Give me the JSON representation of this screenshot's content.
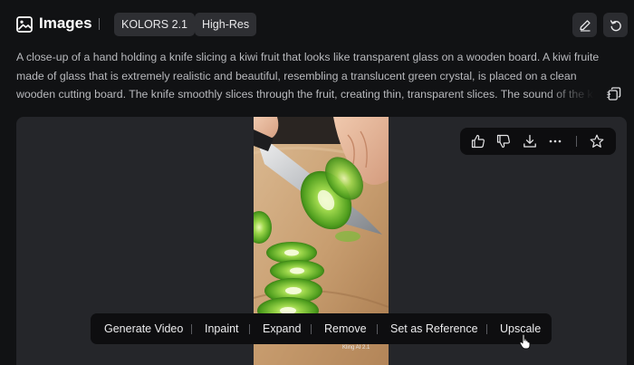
{
  "header": {
    "title": "Images",
    "badges": [
      "KOLORS 2.1",
      "High-Res"
    ]
  },
  "prompt": {
    "text": "A close-up of a hand holding a knife slicing a kiwi fruit that looks like transparent glass on a wooden board. A kiwi fruite made of glass that is extremely realistic and beautiful, resembling a translucent green crystal, is placed on a clean wooden cutting board. The knife smoothly slices through the fruit, creating thin, transparent slices. The sound of the knife cutting through the glass-like"
  },
  "image": {
    "watermark": "Kling AI 2.1"
  },
  "toolbar": {
    "items": [
      "Generate Video",
      "Inpaint",
      "Expand",
      "Remove",
      "Set as Reference",
      "Upscale"
    ]
  },
  "icons": {
    "title": "image-icon",
    "edit": "pencil-icon",
    "undo": "undo-icon",
    "copy": "copy-icon",
    "like": "thumbs-up-icon",
    "dislike": "thumbs-down-icon",
    "download": "download-icon",
    "more": "more-icon",
    "favorite": "star-icon"
  },
  "colors": {
    "background": "#111214",
    "panel": "#25262a",
    "badge": "#2e2f33",
    "kiwi": "#5fb82a"
  }
}
